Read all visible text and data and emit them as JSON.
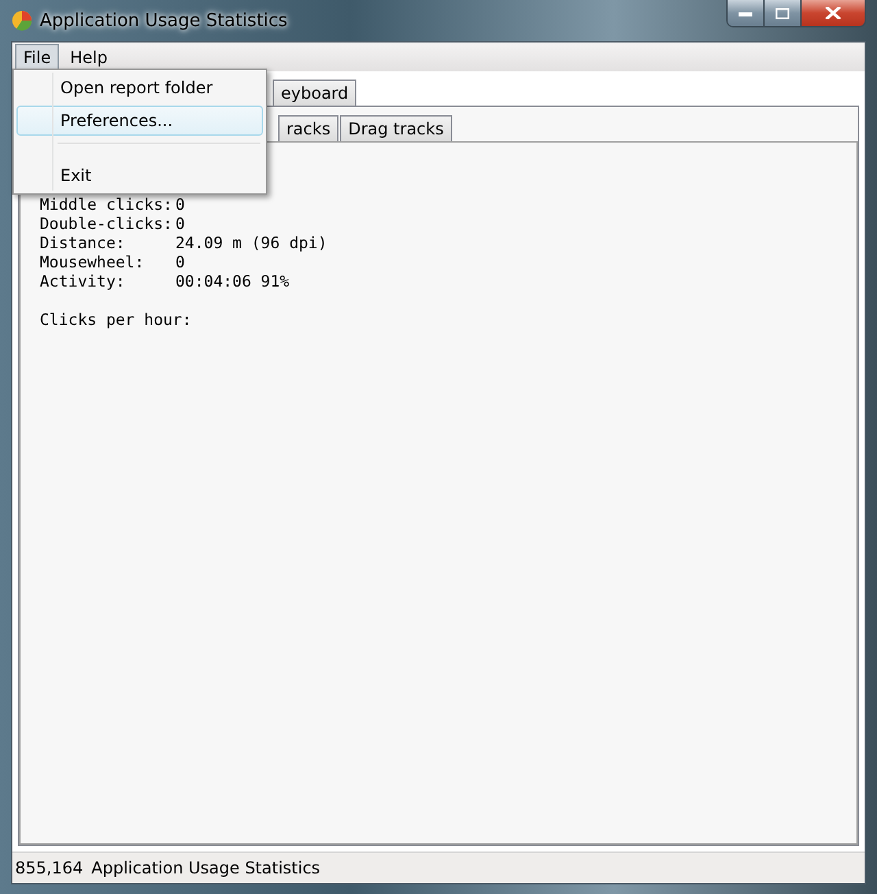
{
  "window": {
    "title": "Application Usage Statistics"
  },
  "menu_bar": [
    {
      "label": "File",
      "selected": true
    },
    {
      "label": "Help",
      "selected": false
    }
  ],
  "file_menu": [
    {
      "kind": "item",
      "label": "Open report folder",
      "selected": false
    },
    {
      "kind": "item",
      "label": "Preferences...",
      "selected": true
    },
    {
      "kind": "separator"
    },
    {
      "kind": "item",
      "label": "Exit",
      "selected": false
    }
  ],
  "tabs": [
    {
      "label": "eyboard",
      "selected": false
    }
  ],
  "subtabs": [
    {
      "label": "racks",
      "selected": false
    },
    {
      "label": "Drag tracks",
      "selected": false
    }
  ],
  "stats": [
    {
      "label": "Middle clicks:",
      "value": "0"
    },
    {
      "label": "Double-clicks:",
      "value": "0"
    },
    {
      "label": "Distance:",
      "value": "24.09 m (96 dpi)"
    },
    {
      "label": "Mousewheel:",
      "value": "0"
    },
    {
      "label": "Activity:",
      "value": "00:04:06 91%"
    }
  ],
  "clicks_per_hour": "Clicks per hour:",
  "status_bar": {
    "count": "855,164",
    "text": "Application Usage Statistics"
  }
}
